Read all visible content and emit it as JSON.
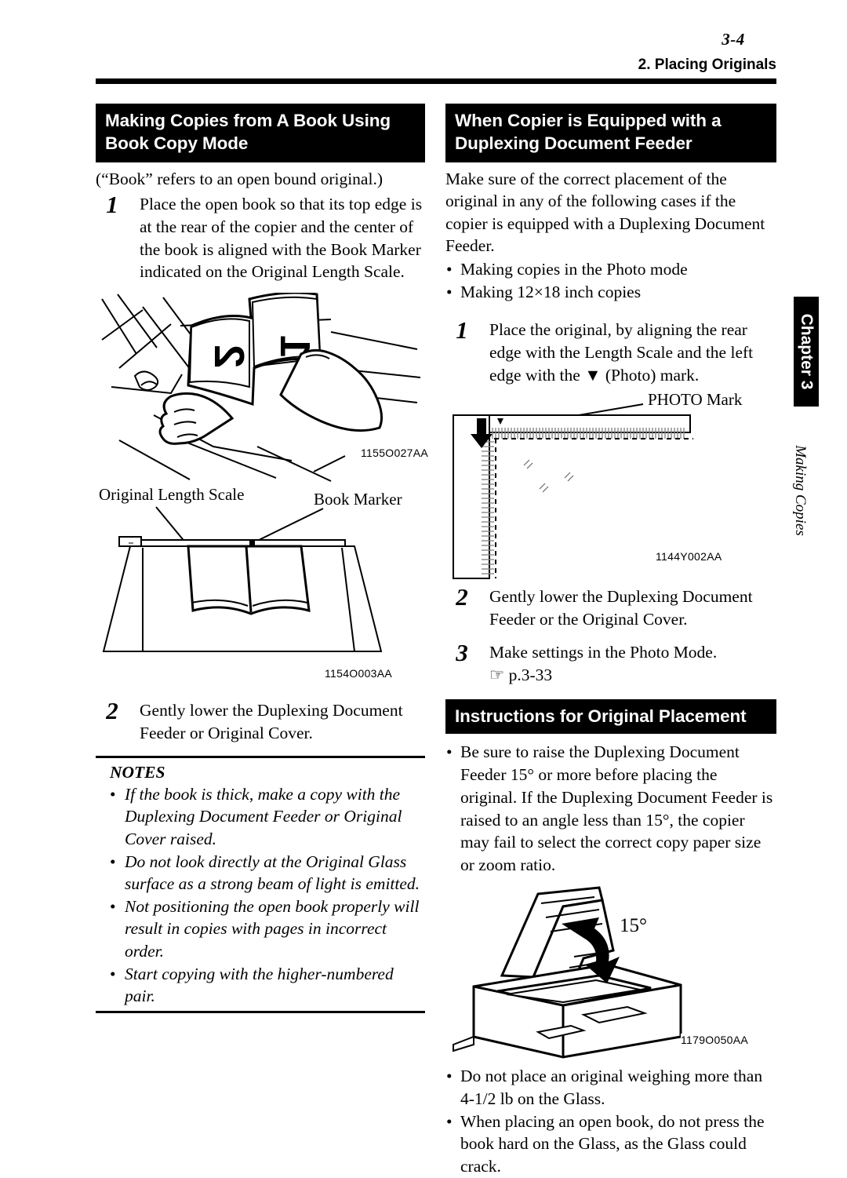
{
  "page": {
    "folio": "3-4",
    "running_head": "2. Placing Originals",
    "side_tab": {
      "chapter": "Chapter 3",
      "section": "Making Copies"
    }
  },
  "left_column": {
    "heading": "Making Copies from A Book Using Book Copy Mode",
    "intro": "(“Book” refers to an open bound original.)",
    "steps": [
      {
        "num": "1",
        "text": "Place the open book so that its top edge is at the rear of the copier and the center of the book is aligned with the Book Marker indicated on the Original Length Scale."
      },
      {
        "num": "2",
        "text": "Gently lower the Duplexing Document Feeder or Original Cover."
      }
    ],
    "figure1": {
      "id": "1155O027AA",
      "page_numbers": "12"
    },
    "figure2": {
      "id": "1154O003AA",
      "callout_left": "Original Length Scale",
      "callout_right": "Book Marker"
    },
    "notes": {
      "title": "NOTES",
      "items": [
        "If the book is thick, make a copy with the Duplexing Document Feeder or Original Cover raised.",
        "Do not look directly at the Original Glass surface as a strong beam of light is emitted.",
        "Not positioning the open book properly will result in copies with pages in incorrect order.",
        "Start copying with the higher-numbered pair."
      ]
    }
  },
  "right_column": {
    "heading": "When Copier is Equipped with a Duplexing Document Feeder",
    "intro": "Make sure of the correct placement of the original in any of the following cases if the copier is equipped with a Duplexing Document Feeder.",
    "bullets": [
      "Making copies in the Photo mode",
      "Making 12×18 inch copies"
    ],
    "steps": [
      {
        "num": "1",
        "text": "Place the original, by aligning the rear edge with the Length Scale and the left edge with the ▼ (Photo) mark."
      },
      {
        "num": "2",
        "text": "Gently lower the Duplexing Document Feeder or the Original Cover."
      },
      {
        "num": "3",
        "text": "Make settings in the Photo Mode.",
        "reference": "☞ p.3-33"
      }
    ],
    "figure1": {
      "id": "1144Y002AA",
      "callout": "PHOTO Mark"
    },
    "section2": {
      "heading": "Instructions for Original Placement",
      "bullets_top": [
        "Be sure to raise the Duplexing Document Feeder 15° or more before placing the original. If the Duplexing Document Feeder is raised to an angle less than 15°, the copier may fail to select the correct copy paper size or zoom ratio."
      ],
      "figure": {
        "id": "1179O050AA",
        "angle_label": "15°"
      },
      "bullets_bottom": [
        "Do not place an original weighing more than 4-1/2 lb on the Glass.",
        "When placing an open book, do not press the book hard on the Glass, as the Glass could crack."
      ]
    }
  }
}
